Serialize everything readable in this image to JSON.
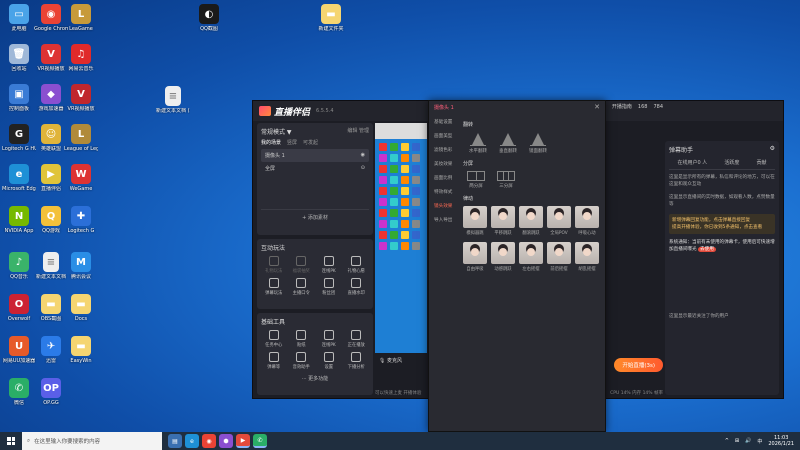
{
  "desktop_icons": [
    {
      "label": "此电脑",
      "color": "#4aa3e8",
      "glyph": "▭"
    },
    {
      "label": "Google Chrome",
      "color": "#ea4335",
      "glyph": "◉"
    },
    {
      "label": "LeaGame",
      "color": "#c79a3a",
      "glyph": "L"
    },
    {
      "label": "回收站",
      "color": "#9fb8d8",
      "glyph": "🗑"
    },
    {
      "label": "VR视频播放",
      "color": "#d33",
      "glyph": "V"
    },
    {
      "label": "网易云音乐",
      "color": "#e02a2a",
      "glyph": "♫"
    },
    {
      "label": "控制面板",
      "color": "#3a7bd5",
      "glyph": "▣"
    },
    {
      "label": "游戏加速器",
      "color": "#8a4fd0",
      "glyph": "◆"
    },
    {
      "label": "VR视频播放",
      "color": "#c0272d",
      "glyph": "V"
    },
    {
      "label": "Logitech G HUB",
      "color": "#222",
      "glyph": "G"
    },
    {
      "label": "英雄联盟",
      "color": "#e0b43a",
      "glyph": "☺"
    },
    {
      "label": "League of Legends",
      "color": "#b08a3a",
      "glyph": "L"
    },
    {
      "label": "Microsoft Edge",
      "color": "#1e90d6",
      "glyph": "e"
    },
    {
      "label": "直播伴侣",
      "color": "#e0c43a",
      "glyph": "▶"
    },
    {
      "label": "WeGame",
      "color": "#d33",
      "glyph": "W"
    },
    {
      "label": "NVIDIA App",
      "color": "#76b900",
      "glyph": "N"
    },
    {
      "label": "QQ游戏",
      "color": "#f3c13a",
      "glyph": "Q"
    },
    {
      "label": "Logitech G",
      "color": "#2b6fd8",
      "glyph": "✚"
    },
    {
      "label": "QQ音乐",
      "color": "#3ab36a",
      "glyph": "♪"
    },
    {
      "label": "新建文本文档",
      "color": "#eee",
      "glyph": "≡"
    },
    {
      "label": "腾讯会议",
      "color": "#2a8ee6",
      "glyph": "M"
    },
    {
      "label": "Overwolf",
      "color": "#c23",
      "glyph": "O"
    },
    {
      "label": "OBS截图",
      "color": "#f5d571",
      "glyph": "▬"
    },
    {
      "label": "Docs",
      "color": "#f5d571",
      "glyph": "▬"
    },
    {
      "label": "网易UU加速器",
      "color": "#e65a2a",
      "glyph": "U"
    },
    {
      "label": "迅雷",
      "color": "#2b7be8",
      "glyph": "✈"
    },
    {
      "label": "EasyWin",
      "color": "#f5d571",
      "glyph": "▬"
    },
    {
      "label": "微信",
      "color": "#2aae67",
      "glyph": "✆"
    },
    {
      "label": "OP.GG",
      "color": "#5a5fe8",
      "glyph": "OP"
    },
    {
      "label": "QQ截图",
      "color": "#1a1a1a",
      "glyph": "◐"
    },
    {
      "label": "新建文件夹",
      "color": "#f5d571",
      "glyph": "▬"
    },
    {
      "label": "新建文本文档 (2).txt",
      "color": "#eee",
      "glyph": "≡"
    }
  ],
  "app": {
    "name": "直播伴侣",
    "version": "6.5.5.4",
    "mode": "常规模式 ▼",
    "edit": "编辑",
    "manage": "管理",
    "scenes_title": "我的场景",
    "tabs": [
      "竖屏",
      "可发起"
    ],
    "scenes": [
      "摄像头 1",
      "全屏"
    ],
    "add_source": "+ 添加素材",
    "interact_title": "互动玩法",
    "interact_tools": [
      "礼物玩法",
      "福袋抽奖",
      "连线PK",
      "礼物心愿",
      "弹幕玩法",
      "主播口令",
      "粉丝团",
      "直播水印"
    ],
    "basic_title": "基础工具",
    "basic_tools": [
      "任务中心",
      "贴纸",
      "连线PK",
      "正在播放",
      "弹幕等",
      "音效助手",
      "设置",
      "下播分析"
    ],
    "more": "··· 更多功能",
    "mic": "麦克风",
    "status_left": "可以快速上麦 开播体验",
    "status_right": "CPU 14%  内存 14%  帧率",
    "go_live": "开始直播(3s)",
    "top_status": [
      "开播指南",
      "168",
      "784"
    ],
    "right_panel": {
      "title": "弹幕助手",
      "tabs": [
        "在线用户0 人",
        "活跃度",
        "贡献"
      ],
      "text1": "这里是显示所有的弹幕，私信和评论的地方，可以在这里和观众互动",
      "text2": "这里显示直播间的实时数据，如观看人数，点赞数量等",
      "notice": "新增弹幕回复功能，点击弹幕直接回复",
      "notice2": "提高开播体验，你已收到5条通知，点击查看",
      "sys": "系统通知：当前有未使用的弹幕卡，使用后可快速增加直播间曝光",
      "sys_tag": "去使用",
      "bottom": "这里显示最近关注了你的用户"
    }
  },
  "popup": {
    "title": "摄像头 1",
    "nav": [
      "基础设置",
      "画面美型",
      "滤镜色彩",
      "美妆效果",
      "画面比例",
      "特效样式",
      "镜头效果",
      "导入导出"
    ],
    "nav_active": 6,
    "flip_title": "翻转",
    "flips": [
      "水平翻转",
      "垂直翻转",
      "镜面翻转"
    ],
    "split_title": "分屏",
    "splits": [
      "两分屏",
      "三分屏"
    ],
    "fx_title": "律动",
    "fx": [
      "模拟器跳",
      "平移跳跃",
      "翻滚跳跃",
      "全局POV",
      "呼吸心动",
      "自由呼吸",
      "动感跳跃",
      "左右摇摆",
      "前后摇摆",
      "胡乱摇摆"
    ]
  },
  "taskbar": {
    "search": "在这里输入你要搜索的内容",
    "apps": [
      "▤",
      "e",
      "◉",
      "⬢",
      "▶",
      "✆"
    ],
    "time": "11:03",
    "date": "2026/1/21",
    "tray": [
      "^",
      "⊞",
      "🔊",
      "中"
    ]
  }
}
